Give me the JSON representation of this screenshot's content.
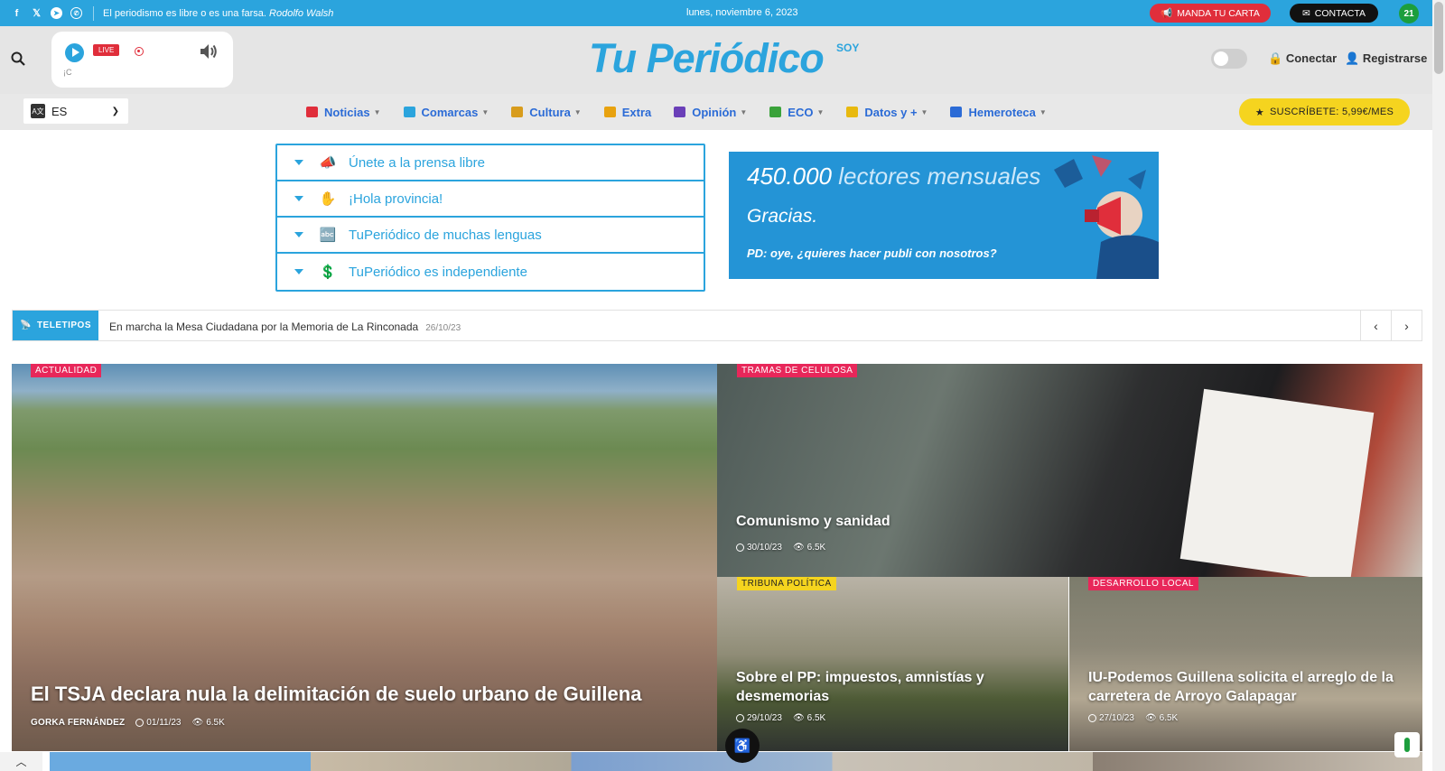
{
  "topbar": {
    "quote_text": "El periodismo es libre o es una farsa.",
    "quote_author": "Rodolfo Walsh",
    "date": "lunes, noviembre 6, 2023",
    "carta_label": "MANDA TU CARTA",
    "contacta_label": "CONTACTA",
    "badge_label": "21"
  },
  "header": {
    "live_label": "LIVE",
    "player_text": "¡C",
    "logo": "Tu Periódico",
    "logo_tag": "SOY",
    "login_label": "Conectar",
    "register_label": "Registrarse"
  },
  "nav": {
    "language": "ES",
    "items": [
      {
        "label": "Noticias",
        "color": "#e02e3b"
      },
      {
        "label": "Comarcas",
        "color": "#2ba4dd"
      },
      {
        "label": "Cultura",
        "color": "#d89c1c"
      },
      {
        "label": "Extra",
        "color": "#e8a20f"
      },
      {
        "label": "Opinión",
        "color": "#6a3fb8"
      },
      {
        "label": "ECO",
        "color": "#3aa23a"
      },
      {
        "label": "Datos y +",
        "color": "#e8b90f"
      },
      {
        "label": "Hemeroteca",
        "color": "#2b6bd6"
      }
    ],
    "subscribe_label": "SUSCRÍBETE: 5,99€/MES"
  },
  "accordion": {
    "items": [
      "Únete a la prensa libre",
      "¡Hola provincia!",
      "TuPeriódico de muchas lenguas",
      "TuPeriódico es independiente"
    ]
  },
  "ad": {
    "number": "450.000",
    "rest": "lectores mensuales",
    "thanks": "Gracias.",
    "pd": "PD: oye, ¿quieres hacer publi con nosotros?"
  },
  "teletipos": {
    "label": "TELETIPOS",
    "headline": "En marcha la Mesa Ciudadana por la Memoria de La Rinconada",
    "date": "26/10/23"
  },
  "articles": [
    {
      "category": "ACTUALIDAD",
      "title": "El TSJA declara nula la delimitación de suelo urbano de Guillena",
      "author": "GORKA FERNÁNDEZ",
      "date": "01/11/23",
      "views": "6.5K",
      "cat_color": "#e8275a"
    },
    {
      "category": "TRAMAS DE CELULOSA",
      "title": "Comunismo y sanidad",
      "date": "30/10/23",
      "views": "6.5K",
      "cat_color": "#e8275a"
    },
    {
      "category": "TRIBUNA POLÍTICA",
      "title": "Sobre el PP: impuestos, amnistías y desmemorias",
      "date": "29/10/23",
      "views": "6.5K",
      "cat_color": "#f5d41f"
    },
    {
      "category": "DESARROLLO LOCAL",
      "title": "IU-Podemos Guillena solicita el arreglo de la carretera de Arroyo Galapagar",
      "date": "27/10/23",
      "views": "6.5K",
      "cat_color": "#e8275a"
    }
  ]
}
